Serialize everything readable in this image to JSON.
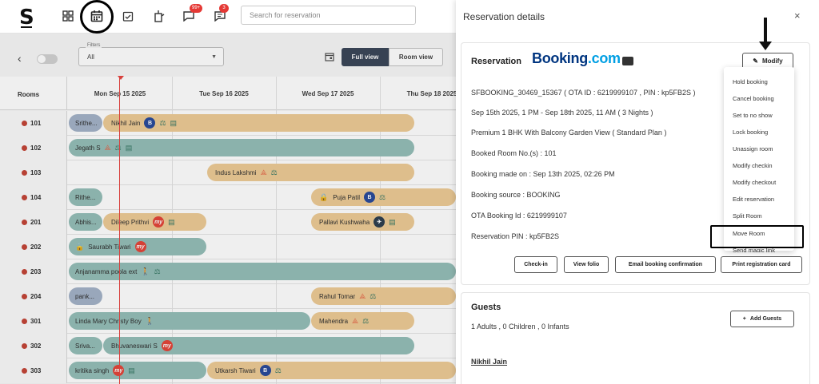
{
  "topbar": {
    "logo": "S",
    "search_placeholder": "Search for reservation",
    "badge_1": "99+",
    "badge_2": "3"
  },
  "filters": {
    "label": "Filters",
    "value": "All",
    "full_view": "Full view",
    "room_view": "Room view"
  },
  "grid": {
    "rooms_header": "Rooms",
    "days": [
      "Mon Sep 15 2025",
      "Tue Sep 16 2025",
      "Wed Sep 17 2025",
      "Thu Sep 18 2025"
    ],
    "rooms": [
      "101",
      "102",
      "103",
      "104",
      "201",
      "202",
      "203",
      "204",
      "301",
      "302",
      "303"
    ],
    "bookings": [
      {
        "text": "Srithe..."
      },
      {
        "text": "Nikhil Jain"
      },
      {
        "text": "Jegath S"
      },
      {
        "text": "Indus Lakshmi"
      },
      {
        "text": "Rithe..."
      },
      {
        "text": "Puja Patil"
      },
      {
        "text": "Abhis..."
      },
      {
        "text": "Dileep Prithvi"
      },
      {
        "text": "Pallavi Kushwaha"
      },
      {
        "text": "Saurabh Tiwari"
      },
      {
        "text": "Anjanamma poola ext"
      },
      {
        "text": "pank..."
      },
      {
        "text": "Rahul Tomar"
      },
      {
        "text": "Linda Mary Christy Boy"
      },
      {
        "text": "Mahendra"
      },
      {
        "text": "Sriva..."
      },
      {
        "text": "Bhuvaneswari S"
      },
      {
        "text": "kritika singh"
      },
      {
        "text": "Utkarsh Tiwari"
      }
    ]
  },
  "panel": {
    "title": "Reservation details",
    "close": "×",
    "reservation_label": "Reservation",
    "ota_brand_a": "Booking",
    "ota_brand_b": ".com",
    "modify_label": "Modify",
    "details": [
      "SFBOOKING_30469_15367 ( OTA ID : 6219999107 , PIN : kp5FB2S )",
      "Sep 15th 2025, 1 PM - Sep 18th 2025, 11 AM ( 3 Nights )",
      "Premium 1 BHK With Balcony Garden View ( Standard Plan )",
      "Booked Room No.(s) : 101",
      "Booking made on : Sep 13th 2025, 02:26 PM",
      "Booking source : BOOKING",
      "OTA Booking Id : 6219999107",
      "Reservation PIN : kp5FB2S"
    ],
    "menu": [
      "Hold booking",
      "Cancel booking",
      "Set to no show",
      "Lock booking",
      "Unassign room",
      "Modify checkin",
      "Modify checkout",
      "Edit reservation",
      "Split Room",
      "Move Room",
      "Send magic link"
    ],
    "actions": [
      "Check-in",
      "View folio",
      "Email booking confirmation",
      "Print registration card"
    ],
    "guests_title": "Guests",
    "guests_count": "1 Adults , 0 Children , 0 Infants",
    "add_guests": "Add Guests",
    "guest_name": "Nikhil Jain"
  }
}
